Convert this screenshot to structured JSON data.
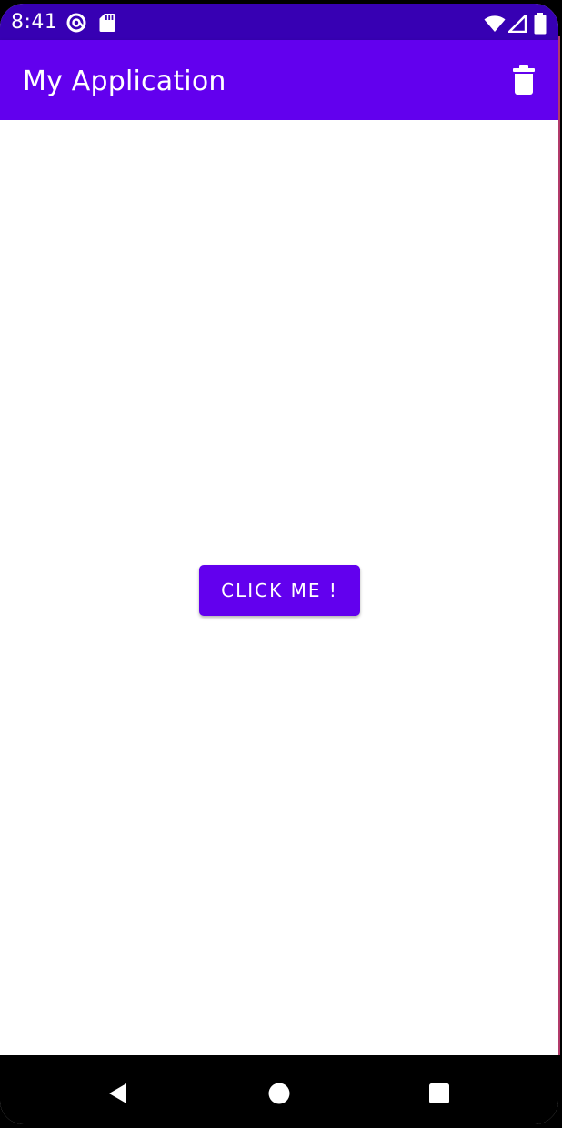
{
  "status_bar": {
    "time": "8:41",
    "icons": [
      "at-sign-icon",
      "sd-card-icon",
      "wifi-icon",
      "cell-signal-icon",
      "battery-icon"
    ],
    "color": "#3700b3"
  },
  "app_bar": {
    "title": "My Application",
    "action_icon": "trash-icon",
    "color": "#6200ee"
  },
  "main": {
    "button_label": "CLICK ME !",
    "button_color": "#6200ee"
  },
  "nav_bar": {
    "icons": [
      "back-icon",
      "home-icon",
      "recents-icon"
    ]
  }
}
